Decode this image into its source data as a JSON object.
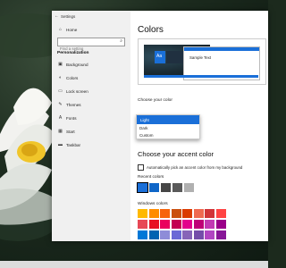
{
  "window": {
    "title": "Settings"
  },
  "sidebar": {
    "home_label": "Home",
    "search_placeholder": "Find a setting",
    "section_title": "Personalization",
    "items": [
      {
        "label": "Background",
        "icon": "picture-icon"
      },
      {
        "label": "Colors",
        "icon": "palette-icon"
      },
      {
        "label": "Lock screen",
        "icon": "monitor-icon"
      },
      {
        "label": "Themes",
        "icon": "brush-icon"
      },
      {
        "label": "Fonts",
        "icon": "font-icon"
      },
      {
        "label": "Start",
        "icon": "start-icon"
      },
      {
        "label": "Taskbar",
        "icon": "taskbar-icon"
      }
    ]
  },
  "main": {
    "title": "Colors",
    "preview_sample_text": "Sample Text",
    "preview_aa": "Aa",
    "choose_color_label": "Choose your color",
    "color_options": [
      "Light",
      "Dark",
      "Custom"
    ],
    "selected_color_option": "Light",
    "accent_title": "Choose your accent color",
    "auto_pick_label": "Automatically pick an accent color from my background",
    "recent_colors_label": "Recent colors",
    "windows_colors_label": "Windows colors"
  },
  "colors": {
    "accent": "#1a6fd8",
    "recent": [
      "#1a6fd8",
      "#0f66c8",
      "#464646",
      "#5a5a5a",
      "#b0b0b0"
    ],
    "windows_grid": [
      [
        "#ffb900",
        "#ff8c00",
        "#f7630c",
        "#ca5010",
        "#da3b01",
        "#ef6950",
        "#d13438",
        "#ff4343"
      ],
      [
        "#e74856",
        "#e81123",
        "#ea005e",
        "#c30052",
        "#e3008c",
        "#bf0077",
        "#c239b3",
        "#9a0089"
      ],
      [
        "#0078d7",
        "#0063b1",
        "#8e8cd8",
        "#6b69d6",
        "#8764b8",
        "#744da9",
        "#b146c2",
        "#881798"
      ],
      [
        "#0099bc",
        "#2d7d9a",
        "#00b7c3",
        "#038387",
        "#00b294",
        "#018574",
        "#00cc6a",
        "#10893e"
      ]
    ]
  }
}
